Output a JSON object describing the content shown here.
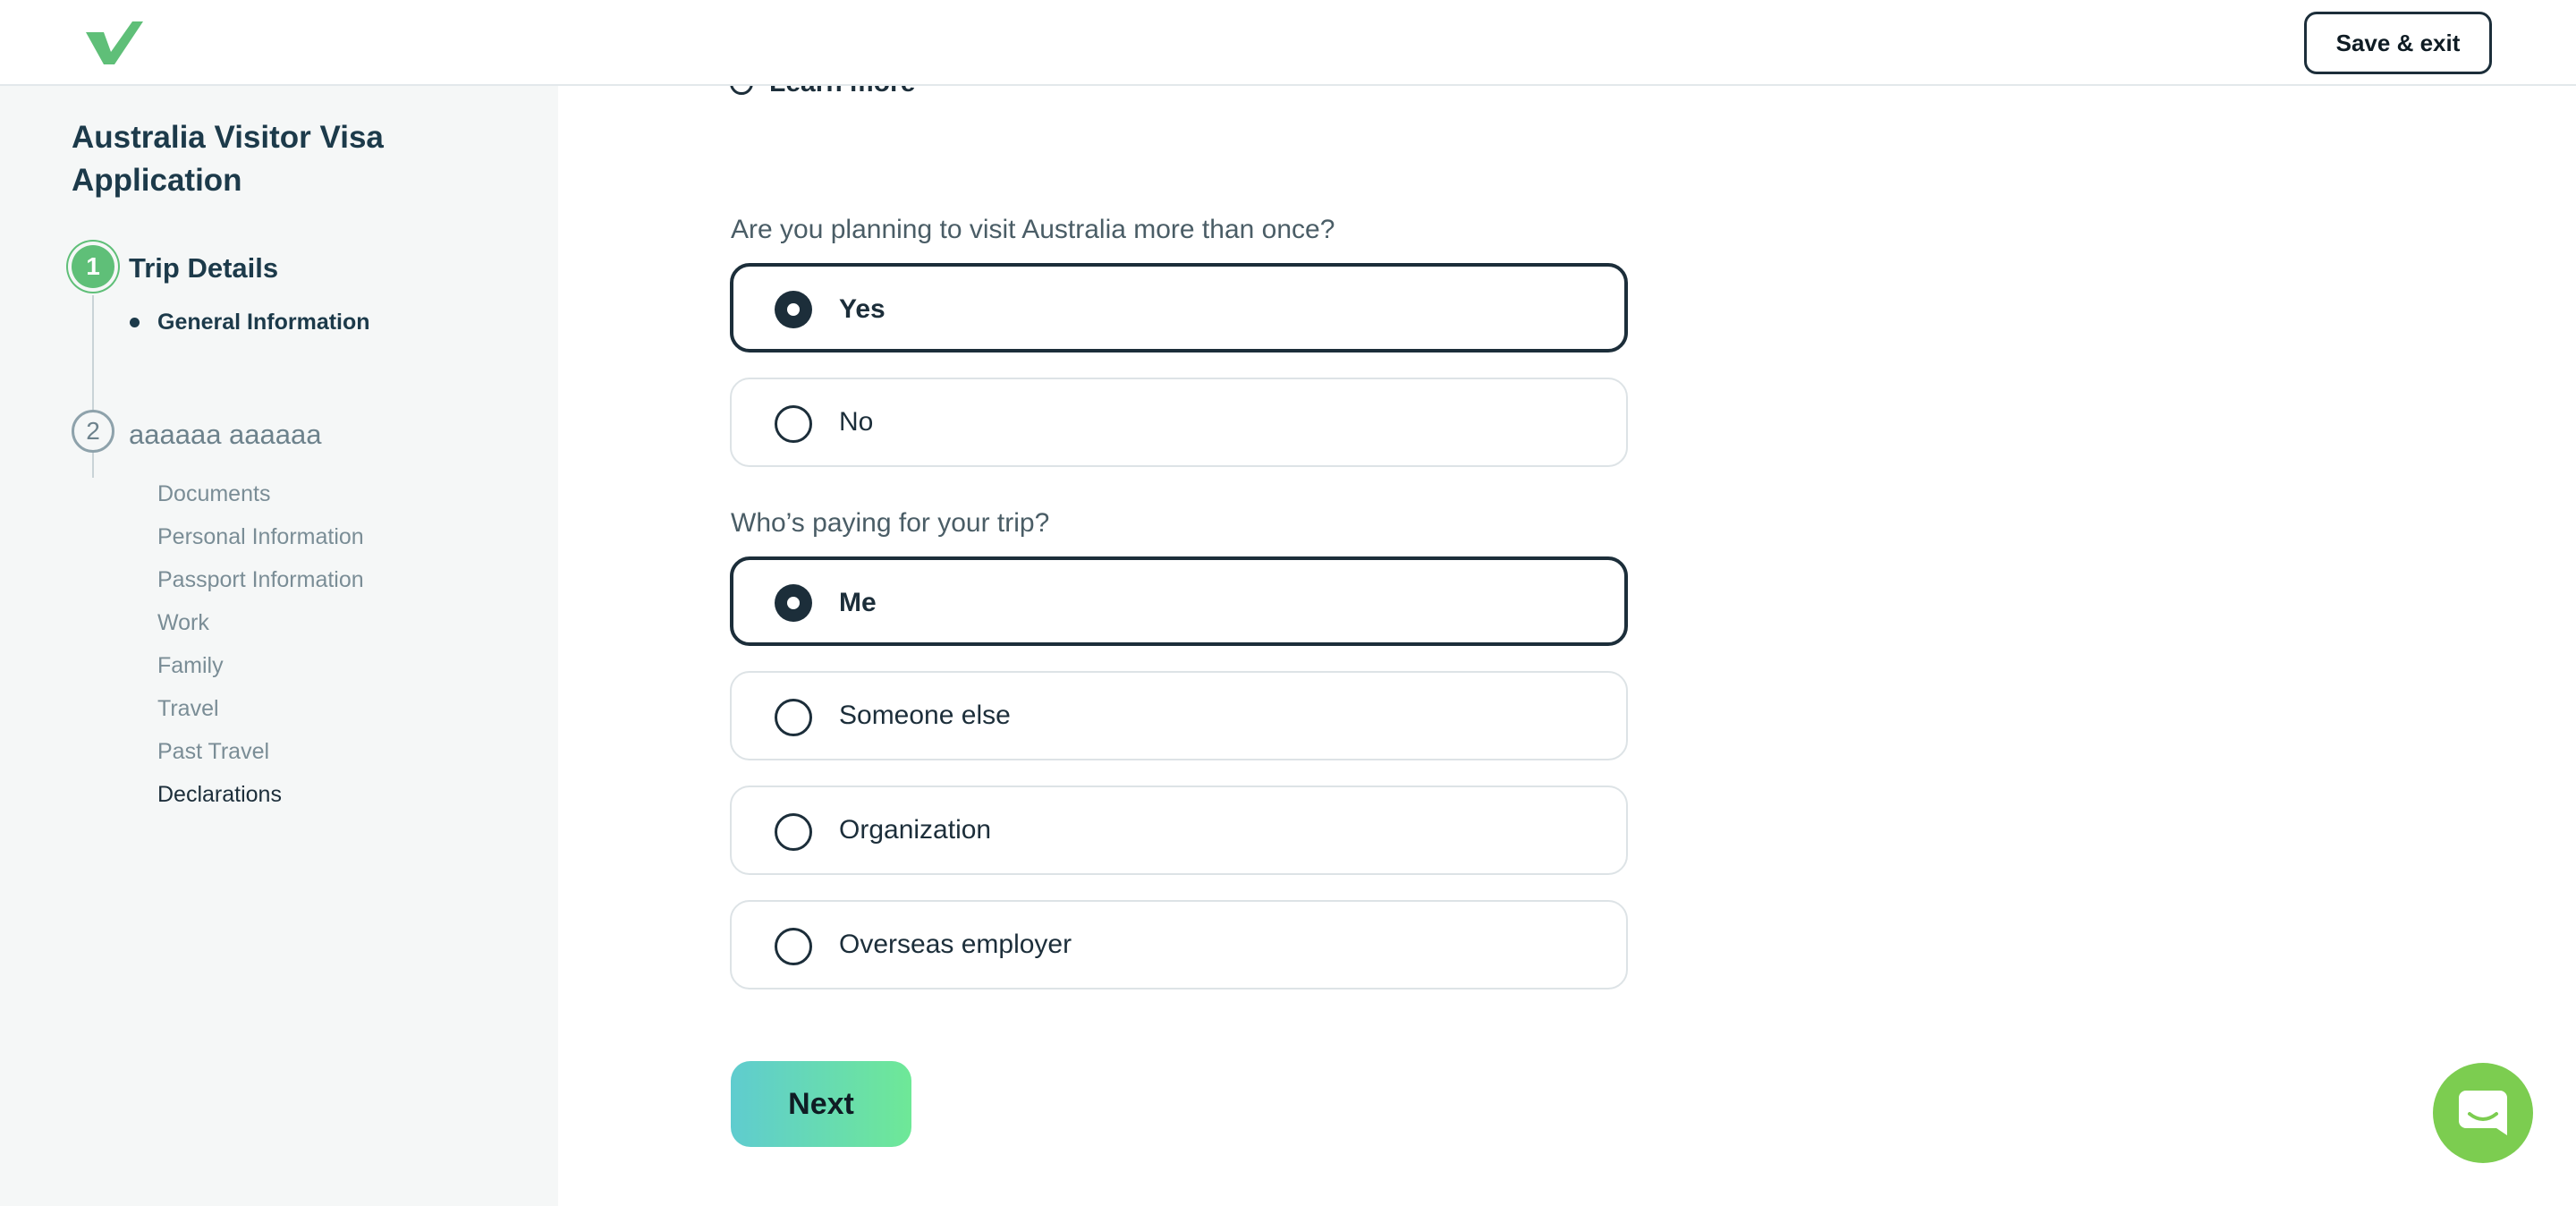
{
  "header": {
    "logo_icon": "checkmark-logo-icon",
    "save_exit_label": "Save & exit"
  },
  "sidebar": {
    "app_title": "Australia Visitor Visa Application",
    "steps": [
      {
        "number": "1",
        "label": "Trip Details",
        "status": "active",
        "substeps": [
          "General Information"
        ]
      },
      {
        "number": "2",
        "label": "aaaaaa aaaaaa",
        "status": "upcoming",
        "substeps": [
          "Documents",
          "Personal Information",
          "Passport Information",
          "Work",
          "Family",
          "Travel",
          "Past Travel",
          "Declarations"
        ]
      }
    ]
  },
  "main": {
    "learn_more_label": "Learn more",
    "questions": [
      {
        "label": "Are you planning to visit Australia more than once?",
        "options": [
          "Yes",
          "No"
        ],
        "selected": "Yes"
      },
      {
        "label": "Who’s paying for your trip?",
        "options": [
          "Me",
          "Someone else",
          "Organization",
          "Overseas employer"
        ],
        "selected": "Me"
      }
    ],
    "next_label": "Next"
  },
  "chat": {
    "icon": "chat-bubble-icon"
  },
  "colors": {
    "brand_green": "#5fbf78",
    "dark_navy": "#1c2e3a",
    "next_gradient_start": "#5fcccf",
    "next_gradient_end": "#6ee897",
    "chat_green": "#7ccd50",
    "sidebar_bg": "#f5f7f7"
  }
}
